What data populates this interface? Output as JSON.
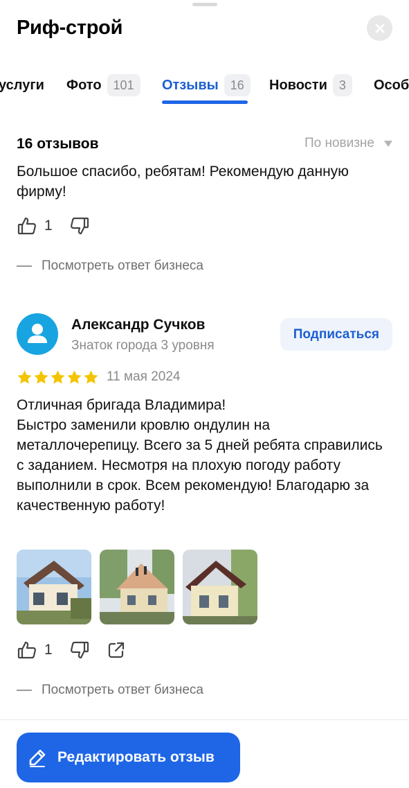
{
  "header": {
    "title": "Риф-строй",
    "close_icon": "close-icon"
  },
  "tabs": [
    {
      "label": "услуги",
      "count": null,
      "active": false
    },
    {
      "label": "Фото",
      "count": "101",
      "active": false
    },
    {
      "label": "Отзывы",
      "count": "16",
      "active": true
    },
    {
      "label": "Новости",
      "count": "3",
      "active": false
    },
    {
      "label": "Особ",
      "count": null,
      "active": false
    }
  ],
  "reviews_header": {
    "count_label": "16 отзывов",
    "sort_label": "По новизне"
  },
  "previous_review": {
    "text": "Большое спасибо, ребятам! Рекомендую данную фирму!",
    "likes": "1",
    "business_reply_link": "Посмотреть ответ бизнеса"
  },
  "review": {
    "author_name": "Александр Сучков",
    "author_level": "Знаток города 3 уровня",
    "subscribe_label": "Подписаться",
    "rating": 5,
    "date": "11 мая 2024",
    "text": "Отличная бригада Владимира!\nБыстро заменили кровлю ондулин на металлочерепицу. Всего за 5 дней ребята справились с заданием. Несмотря на плохую погоду работу выполнили в срок. Всем рекомендую! Благодарю за качественную работу!",
    "photos": [
      "house-roof-photo-1",
      "house-roof-photo-2",
      "house-roof-photo-3"
    ],
    "likes": "1",
    "business_reply_link": "Посмотреть ответ бизнеса"
  },
  "footer": {
    "edit_button_label": "Редактировать отзыв"
  },
  "colors": {
    "accent": "#1e66e6",
    "star": "#f5c400",
    "avatar": "#18a4e0"
  }
}
